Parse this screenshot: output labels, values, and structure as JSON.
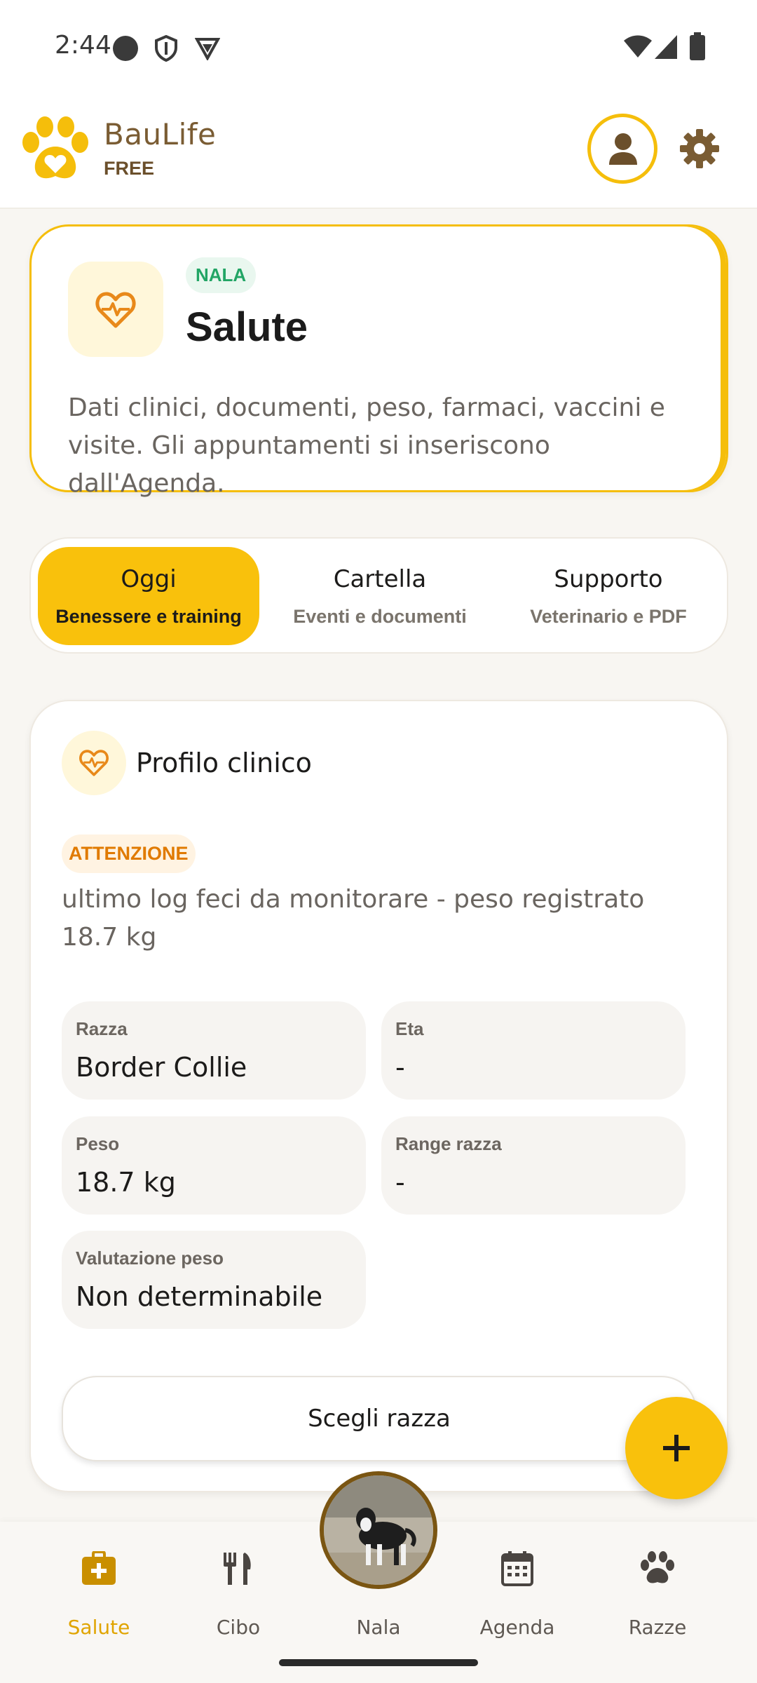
{
  "status_bar": {
    "time": "2:44",
    "icons": [
      "record-dot-icon",
      "shield-icon",
      "vpn-icon",
      "wifi-icon",
      "signal-icon",
      "battery-icon"
    ]
  },
  "header": {
    "brand_name": "BauLife",
    "plan": "FREE",
    "logo_icon": "paw-heart-icon",
    "profile_icon": "person-icon",
    "settings_icon": "gear-icon"
  },
  "hero": {
    "pet_badge": "NALA",
    "title": "Salute",
    "description": "Dati clinici, documenti, peso, farmaci, vaccini e visite. Gli appuntamenti si inseriscono dall'Agenda.",
    "icon": "heart-pulse-icon"
  },
  "tabs": [
    {
      "label": "Oggi",
      "sub": "Benessere e training",
      "active": true
    },
    {
      "label": "Cartella",
      "sub": "Eventi e documenti",
      "active": false
    },
    {
      "label": "Supporto",
      "sub": "Veterinario e PDF",
      "active": false
    }
  ],
  "clinical": {
    "title": "Profilo clinico",
    "warning_badge": "ATTENZIONE",
    "warning_text": "ultimo log feci da monitorare - peso registrato 18.7 kg",
    "fields": [
      {
        "label": "Razza",
        "value": "Border Collie"
      },
      {
        "label": "Eta",
        "value": "-"
      },
      {
        "label": "Peso",
        "value": "18.7 kg"
      },
      {
        "label": "Range razza",
        "value": "-"
      },
      {
        "label": "Valutazione peso",
        "value": "Non determinabile"
      }
    ],
    "choose_button": "Scegli razza"
  },
  "fab": {
    "icon": "plus-icon"
  },
  "bottom_nav": [
    {
      "label": "Salute",
      "icon": "medical-kit-icon",
      "active": true
    },
    {
      "label": "Cibo",
      "icon": "fork-knife-icon",
      "active": false
    },
    {
      "label": "Nala",
      "icon": "pet-avatar",
      "active": false
    },
    {
      "label": "Agenda",
      "icon": "calendar-icon",
      "active": false
    },
    {
      "label": "Razze",
      "icon": "paw-icon",
      "active": false
    }
  ],
  "colors": {
    "accent": "#F9C10C",
    "brand_brown": "#7A5C33",
    "success_green": "#22A565",
    "warning_orange": "#E07A00",
    "background": "#F8F6F2"
  }
}
